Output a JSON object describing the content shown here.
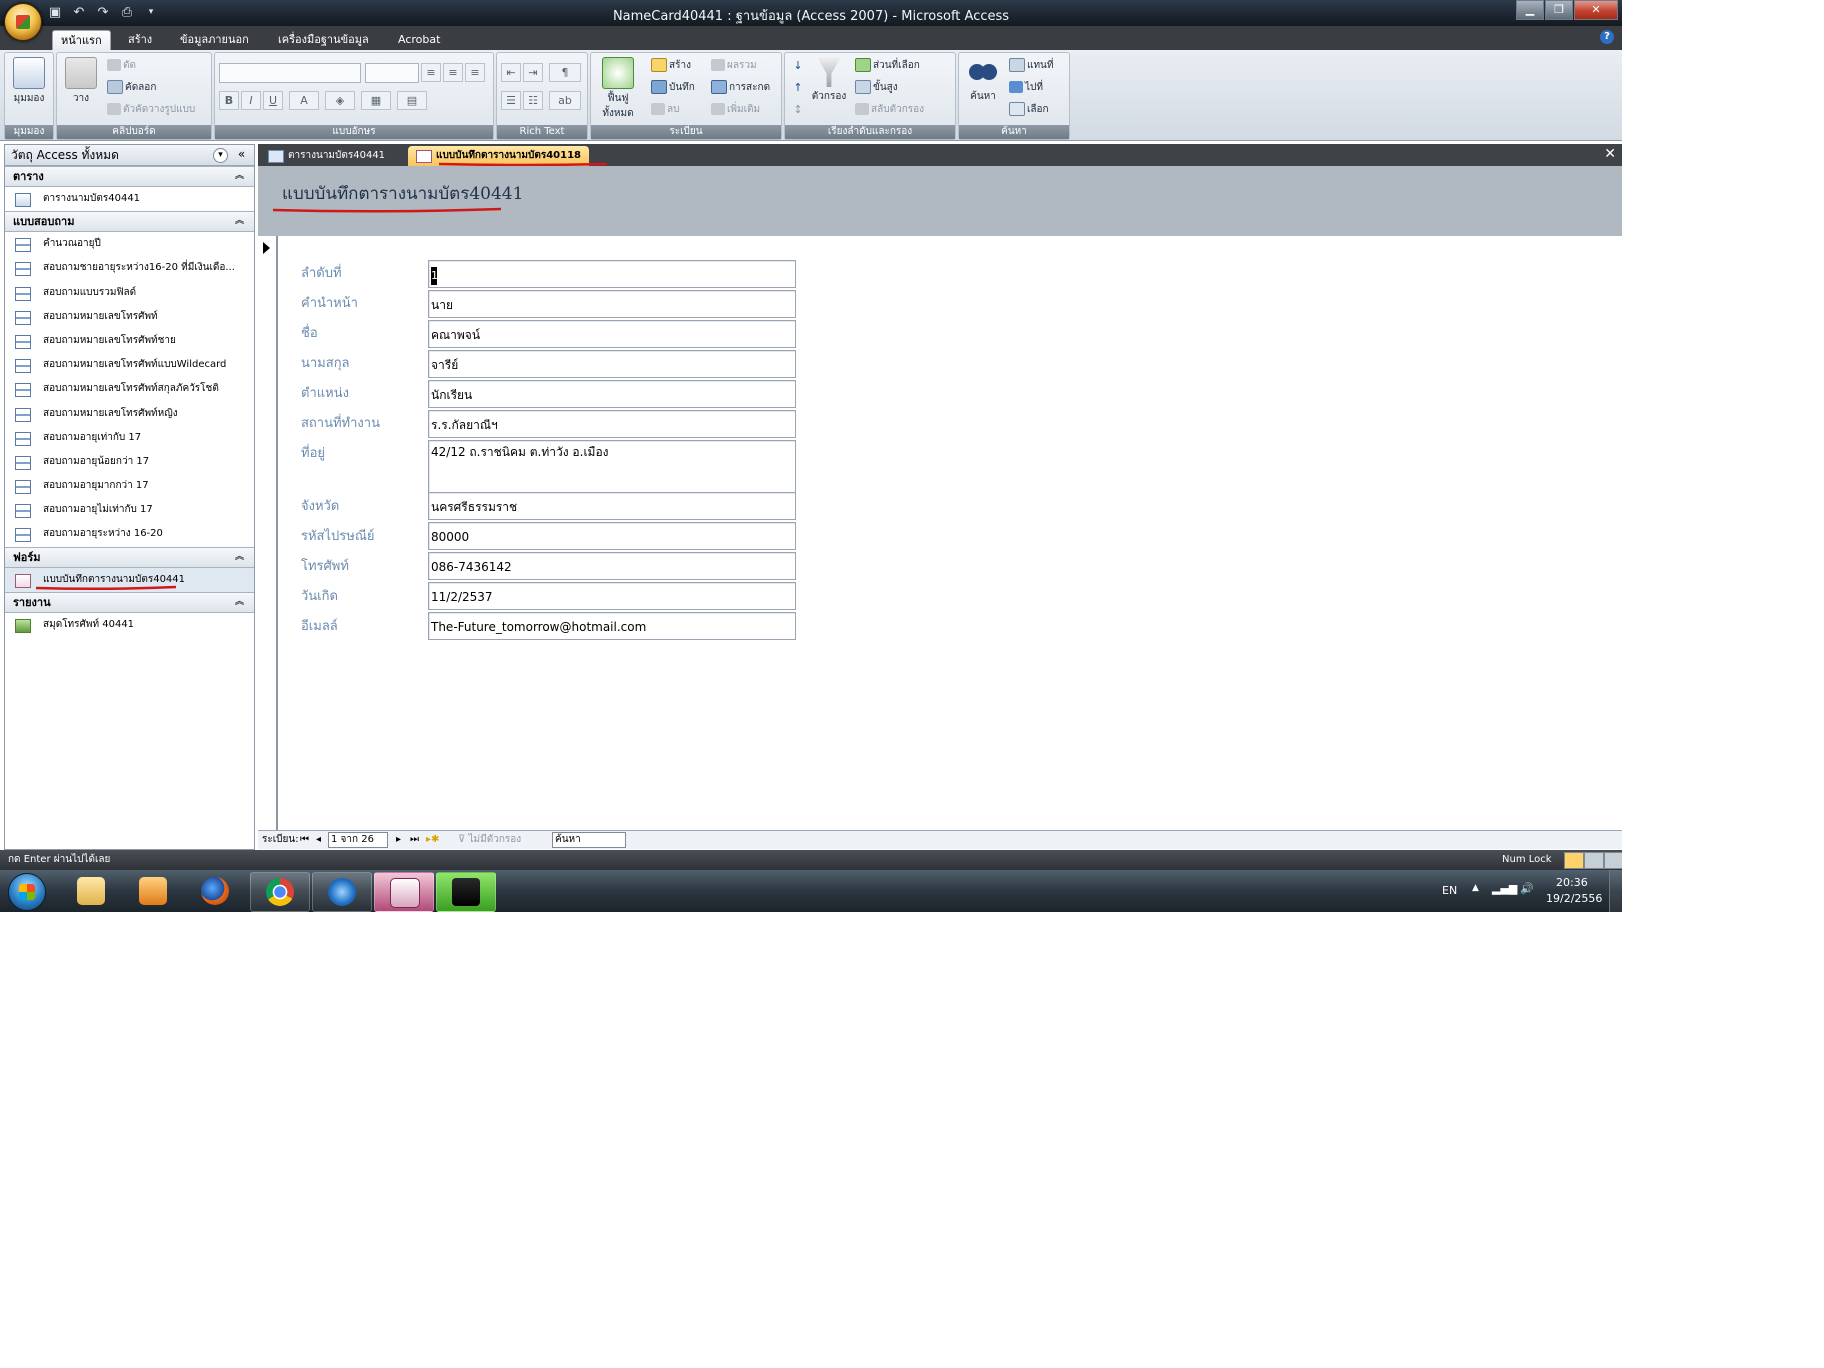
{
  "window": {
    "title": "NameCard40441 : ฐานข้อมูล (Access 2007) - Microsoft Access",
    "controls": [
      "minimize",
      "maximize",
      "close"
    ]
  },
  "qat": {
    "icons": [
      "save-icon",
      "undo-icon",
      "redo-icon",
      "print-preview-icon"
    ]
  },
  "ribbon_tabs": [
    "หน้าแรก",
    "สร้าง",
    "ข้อมูลภายนอก",
    "เครื่องมือฐานข้อมูล",
    "Acrobat"
  ],
  "ribbon": {
    "views": {
      "label": "มุมมอง",
      "button": "มุมมอง"
    },
    "clipboard": {
      "label": "คลิปบอร์ด",
      "paste": "วาง",
      "cut": "ตัด",
      "copy": "คัดลอก",
      "format_painter": "ตัวคัดวางรูปแบบ"
    },
    "font": {
      "label": "แบบอักษร",
      "buttons": [
        "B",
        "I",
        "U",
        "A"
      ]
    },
    "rich_text": {
      "label": "Rich Text"
    },
    "records": {
      "label": "ระเบียน",
      "refresh": "ฟื้นฟูทั้งหมด",
      "new": "สร้าง",
      "save": "บันทึก",
      "delete": "ลบ",
      "totals": "ผลรวม",
      "spelling": "การสะกด",
      "more": "เพิ่มเติม"
    },
    "sort_filter": {
      "label": "เรียงลำดับและกรอง",
      "filter": "ตัวกรอง",
      "selection": "ส่วนที่เลือก",
      "advanced": "ขั้นสูง",
      "toggle_filter": "สลับตัวกรอง"
    },
    "find": {
      "label": "ค้นหา",
      "find": "ค้นหา",
      "replace": "แทนที่",
      "goto": "ไปที่",
      "select": "เลือก"
    }
  },
  "nav_pane": {
    "header": "วัตถุ Access ทั้งหมด",
    "groups": {
      "tables": {
        "title": "ตาราง",
        "items": [
          "ตารางนามบัตร40441"
        ]
      },
      "queries": {
        "title": "แบบสอบถาม",
        "items": [
          "คำนวณอายุปี",
          "สอบถามชายอายุระหว่าง16-20 ที่มีเงินเดือ...",
          "สอบถามแบบรวมฟิลด์",
          "สอบถามหมายเลขโทรศัพท์",
          "สอบถามหมายเลขโทรศัพท์ชาย",
          "สอบถามหมายเลขโทรศัพท์แบบWildecard",
          "สอบถามหมายเลขโทรศัพท์สกุลภัควัรโชติ",
          "สอบถามหมายเลขโทรศัพท์หญิง",
          "สอบถามอายุเท่ากับ 17",
          "สอบถามอายุน้อยกว่า 17",
          "สอบถามอายุมากกว่า 17",
          "สอบถามอายุไม่เท่ากับ 17",
          "สอบถามอายุระหว่าง 16-20"
        ]
      },
      "forms": {
        "title": "ฟอร์ม",
        "items": [
          "แบบบันทึกตารางนามบัตร40441"
        ]
      },
      "reports": {
        "title": "รายงาน",
        "items": [
          "สมุดโทรศัพท์ 40441"
        ]
      }
    }
  },
  "doc_tabs": [
    "ตารางนามบัตร40441",
    "แบบบันทึกตารางนามบัตร40118"
  ],
  "form": {
    "title": "แบบบันทึกตารางนามบัตร40441",
    "fields": [
      {
        "label": "ลำดับที่",
        "value": "1"
      },
      {
        "label": "คำนำหน้า",
        "value": "นาย"
      },
      {
        "label": "ชื่อ",
        "value": "คณาพจน์"
      },
      {
        "label": "นามสกุล",
        "value": "จารีย์"
      },
      {
        "label": "ตำแหน่ง",
        "value": "นักเรียน"
      },
      {
        "label": "สถานที่ทำงาน",
        "value": "ร.ร.กัลยาณีฯ"
      },
      {
        "label": "ที่อยู่",
        "value": "42/12 ถ.ราชนิคม ต.ท่าวัง อ.เมือง"
      },
      {
        "label": "จังหวัด",
        "value": "นครศรีธรรมราช"
      },
      {
        "label": "รหัสไปรษณีย์",
        "value": "80000"
      },
      {
        "label": "โทรศัพท์",
        "value": "086-7436142"
      },
      {
        "label": "วันเกิด",
        "value": "11/2/2537"
      },
      {
        "label": "อีเมลล์",
        "value": "The-Future_tomorrow@hotmail.com"
      }
    ]
  },
  "record_nav": {
    "label": "ระเบียน:",
    "position": "1 จาก 26",
    "filter": "ไม่มีตัวกรอง",
    "search_placeholder": "ค้นหา"
  },
  "status": {
    "text": "กด Enter ผ่านไปได้เลย",
    "numlock": "Num Lock"
  },
  "taskbar": {
    "apps": [
      "windows-explorer",
      "media-player",
      "firefox",
      "chrome",
      "internet-explorer",
      "access",
      "steam"
    ],
    "lang": "EN",
    "time": "20:36",
    "date": "19/2/2556"
  },
  "colors": {
    "annotation_underline": "#d01818",
    "active_tab": "#fbc35a",
    "form_header": "#b0b8c2",
    "label_text": "#6a8bb0"
  }
}
